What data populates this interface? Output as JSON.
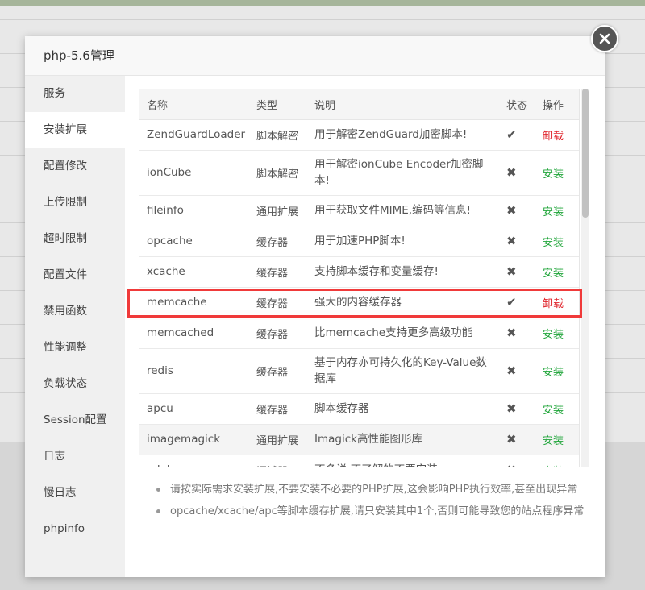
{
  "modal": {
    "title": "php-5.6管理",
    "close_icon": "close-icon"
  },
  "sidebar": {
    "items": [
      {
        "label": "服务",
        "active": false
      },
      {
        "label": "安装扩展",
        "active": true
      },
      {
        "label": "配置修改",
        "active": false
      },
      {
        "label": "上传限制",
        "active": false
      },
      {
        "label": "超时限制",
        "active": false
      },
      {
        "label": "配置文件",
        "active": false
      },
      {
        "label": "禁用函数",
        "active": false
      },
      {
        "label": "性能调整",
        "active": false
      },
      {
        "label": "负载状态",
        "active": false
      },
      {
        "label": "Session配置",
        "active": false
      },
      {
        "label": "日志",
        "active": false
      },
      {
        "label": "慢日志",
        "active": false
      },
      {
        "label": "phpinfo",
        "active": false
      }
    ]
  },
  "table": {
    "headers": {
      "name": "名称",
      "type": "类型",
      "desc": "说明",
      "status": "状态",
      "action": "操作"
    },
    "rows": [
      {
        "name": "ZendGuardLoader",
        "type": "脚本解密",
        "desc": "用于解密ZendGuard加密脚本!",
        "status": "check-icon",
        "action": "卸载"
      },
      {
        "name": "ionCube",
        "type": "脚本解密",
        "desc": "用于解密ionCube Encoder加密脚本!",
        "status": "cross-icon",
        "action": "安装"
      },
      {
        "name": "fileinfo",
        "type": "通用扩展",
        "desc": "用于获取文件MIME,编码等信息!",
        "status": "cross-icon",
        "action": "安装"
      },
      {
        "name": "opcache",
        "type": "缓存器",
        "desc": "用于加速PHP脚本!",
        "status": "cross-icon",
        "action": "安装"
      },
      {
        "name": "xcache",
        "type": "缓存器",
        "desc": "支持脚本缓存和变量缓存!",
        "status": "cross-icon",
        "action": "安装"
      },
      {
        "name": "memcache",
        "type": "缓存器",
        "desc": "强大的内容缓存器",
        "status": "check-icon",
        "action": "卸载"
      },
      {
        "name": "memcached",
        "type": "缓存器",
        "desc": "比memcache支持更多高级功能",
        "status": "cross-icon",
        "action": "安装"
      },
      {
        "name": "redis",
        "type": "缓存器",
        "desc": "基于内存亦可持久化的Key-Value数据库",
        "status": "cross-icon",
        "action": "安装"
      },
      {
        "name": "apcu",
        "type": "缓存器",
        "desc": "脚本缓存器",
        "status": "cross-icon",
        "action": "安装"
      },
      {
        "name": "imagemagick",
        "type": "通用扩展",
        "desc": "Imagick高性能图形库",
        "status": "cross-icon",
        "action": "安装"
      },
      {
        "name": "xdebug",
        "type": "调试器",
        "desc": "不多说,不了解的不要安装",
        "status": "cross-icon",
        "action": "安装"
      }
    ]
  },
  "notes": [
    "请按实际需求安装扩展,不要安装不必要的PHP扩展,这会影响PHP执行效率,甚至出现异常",
    "opcache/xcache/apc等脚本缓存扩展,请只安装其中1个,否则可能导致您的站点程序异常"
  ],
  "colors": {
    "uninstall": "#e0242b",
    "install": "#20a53a",
    "highlight": "#f03a3a"
  }
}
